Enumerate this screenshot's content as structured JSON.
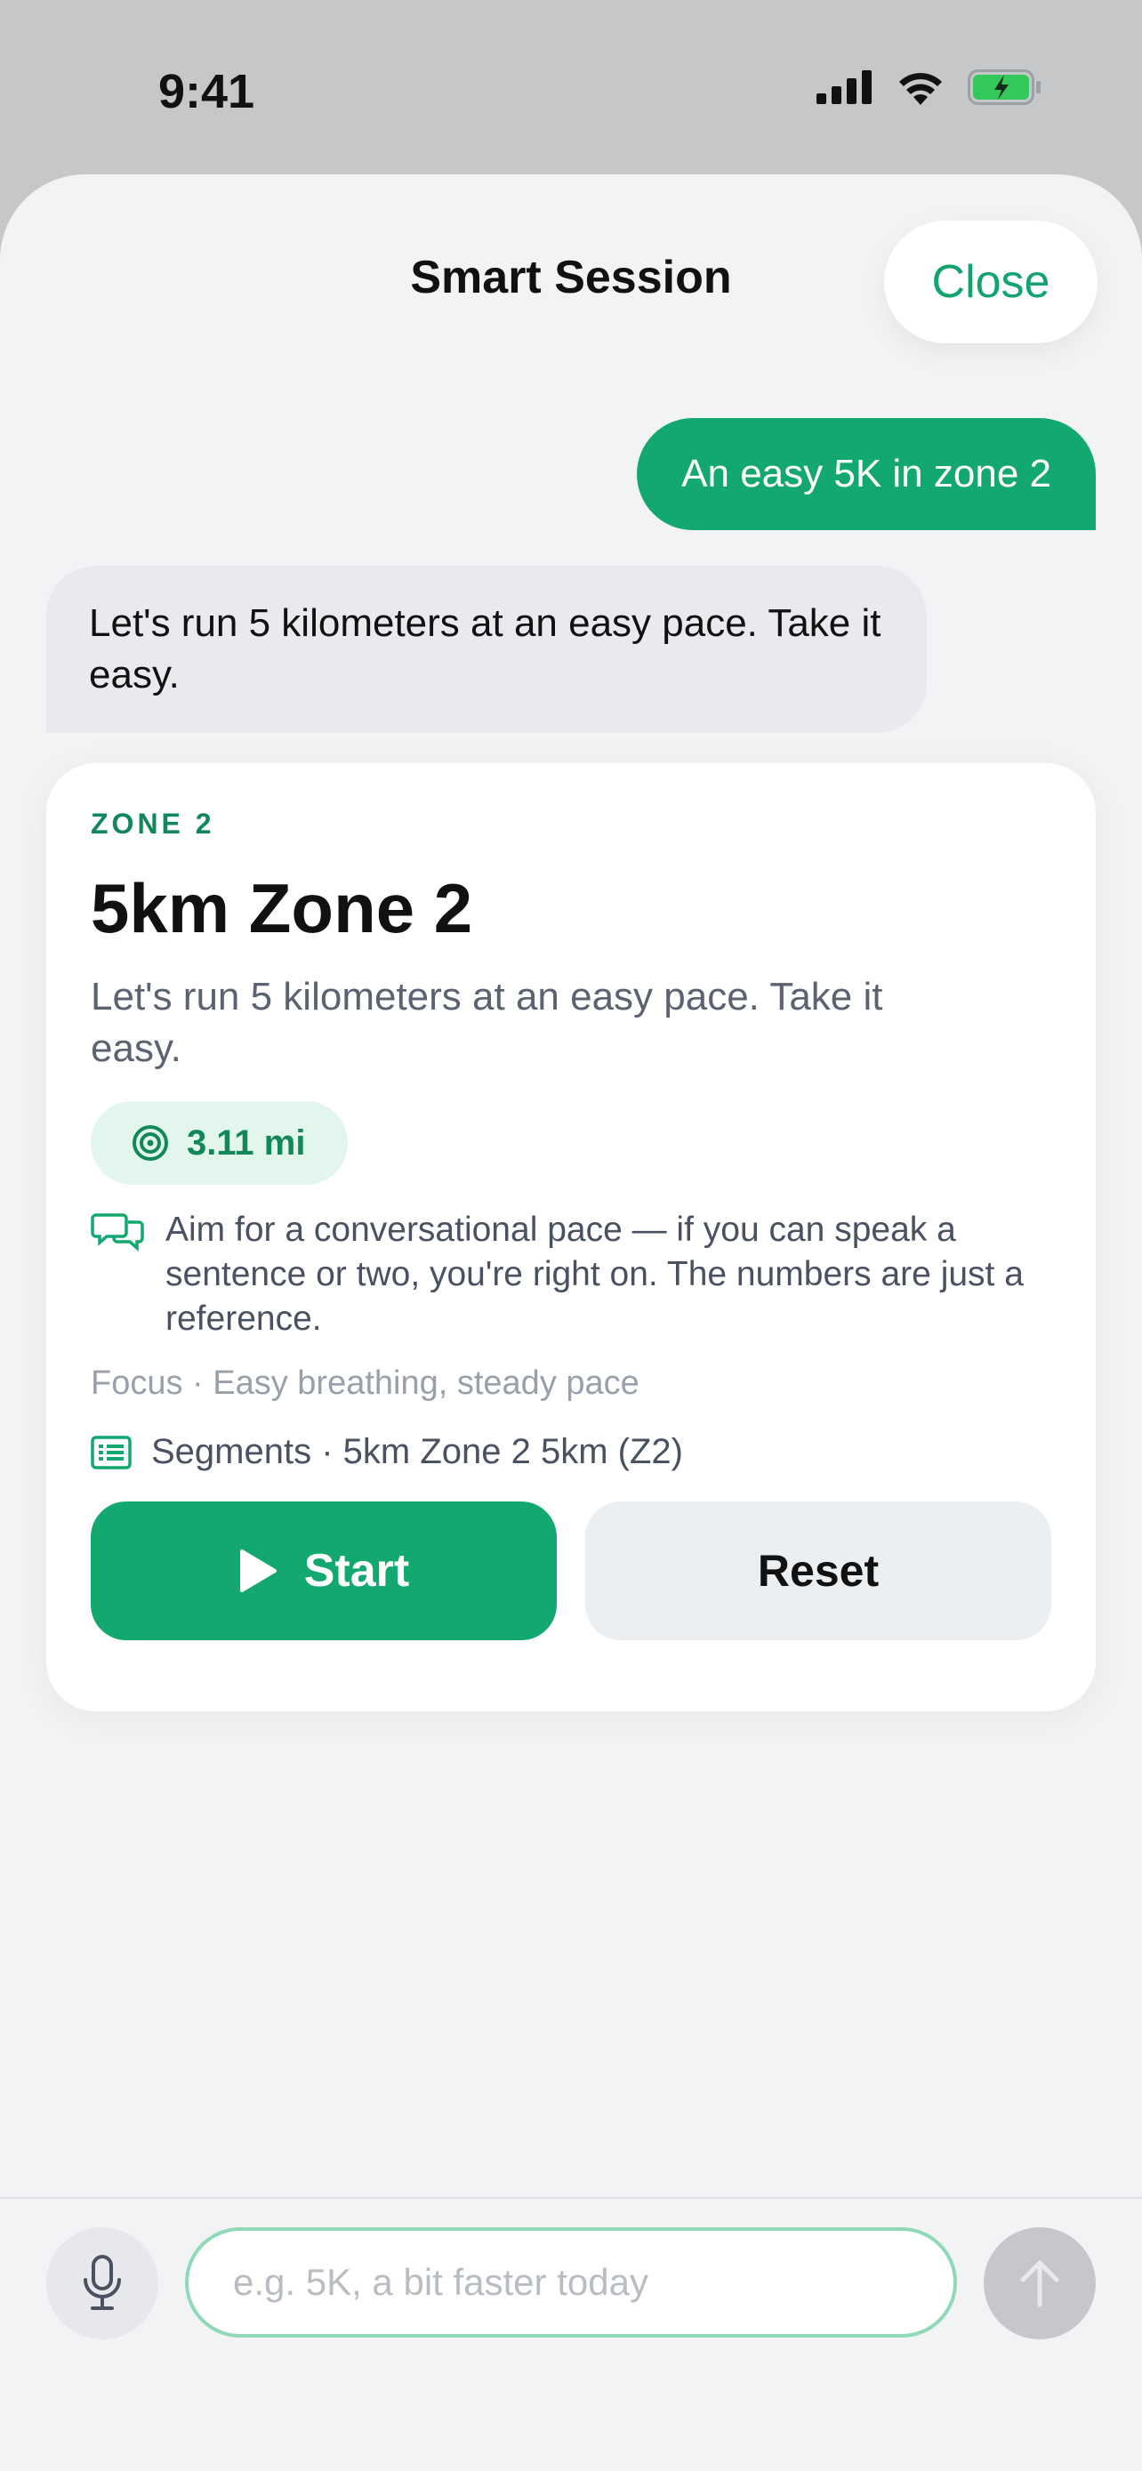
{
  "status_bar": {
    "time": "9:41"
  },
  "header": {
    "title": "Smart Session",
    "close_label": "Close"
  },
  "chat": {
    "user_message": "An easy 5K in zone 2",
    "bot_message": "Let's run 5 kilometers at an easy pace. Take it easy."
  },
  "card": {
    "eyebrow": "ZONE 2",
    "title": "5km Zone 2",
    "description": "Let's run 5 kilometers at an easy pace. Take it easy.",
    "distance": "3.11 mi",
    "tip": "Aim for a conversational pace — if you can speak a sentence or two, you're right on. The numbers are just a reference.",
    "focus": "Focus · Easy breathing, steady pace",
    "segments": "Segments · 5km Zone 2 5km (Z2)",
    "start_label": "Start",
    "reset_label": "Reset"
  },
  "composer": {
    "placeholder": "e.g. 5K, a bit faster today"
  },
  "colors": {
    "accent": "#12a870",
    "accent_dark": "#11875c",
    "chip_bg": "#e3f6ee",
    "battery": "#34c759"
  },
  "icons": [
    "cellular-signal-icon",
    "wifi-icon",
    "battery-charging-icon",
    "target-icon",
    "chat-bubbles-icon",
    "list-icon",
    "play-icon",
    "microphone-icon",
    "arrow-up-icon"
  ]
}
